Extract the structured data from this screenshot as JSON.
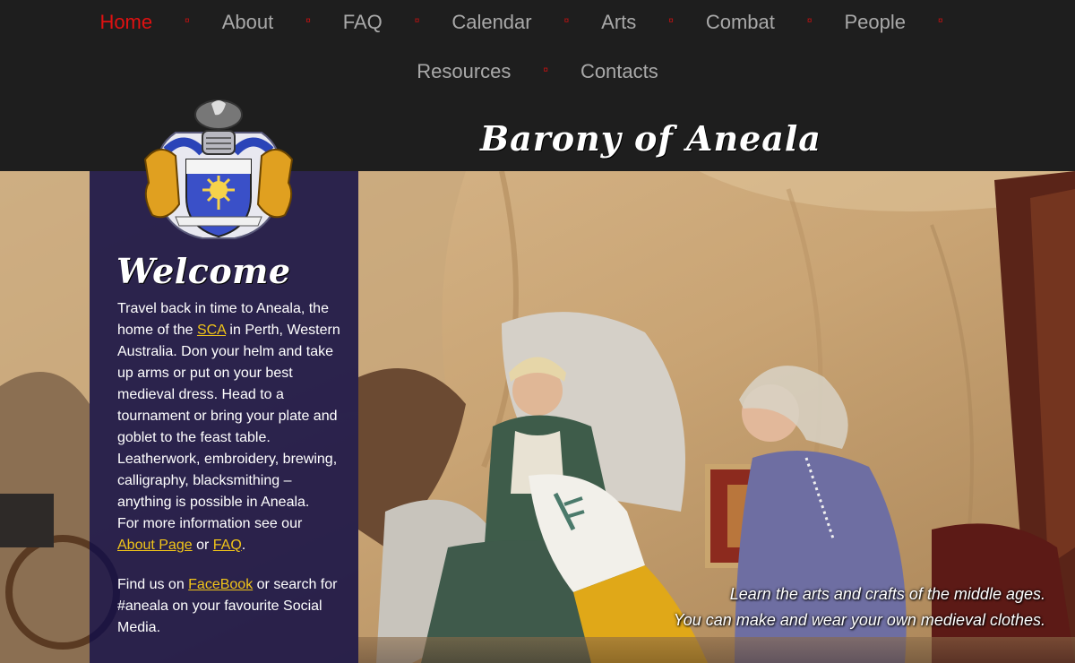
{
  "nav": {
    "row1": [
      "Home",
      "About",
      "FAQ",
      "Calendar",
      "Arts",
      "Combat",
      "People"
    ],
    "row2": [
      "Resources",
      "Contacts"
    ],
    "separator": "¤",
    "active": "Home"
  },
  "site": {
    "title": "Barony of Aneala"
  },
  "welcome": {
    "heading": "Welcome",
    "p1_before": "Travel back in time to Aneala, the home of the ",
    "p1_link": "SCA",
    "p1_after": " in Perth, Western Australia. Don your helm and take up arms or put on your best medieval dress. Head to a tournament or bring your plate and goblet to the feast table. Leatherwork, embroidery, brewing, calligraphy, blacksmithing – anything is possible in Aneala.",
    "p2_before": "For more information see our ",
    "p2_link1": "About Page",
    "p2_mid": " or ",
    "p2_link2": "FAQ",
    "p2_after": ".",
    "p3_before": "Find us on ",
    "p3_link": "FaceBook",
    "p3_after": " or search for #aneala on your favourite Social Media."
  },
  "hero": {
    "caption_line1": "Learn the arts and crafts of the middle ages.",
    "caption_line2": "You can make and wear your own medieval clothes."
  },
  "colors": {
    "header_bg": "#1e1e1e",
    "nav_text": "#a9a9a9",
    "nav_active": "#e01111",
    "panel_bg": "#141046",
    "link": "#f0c419"
  },
  "icons": {
    "crest": "heraldic-crest-icon"
  }
}
